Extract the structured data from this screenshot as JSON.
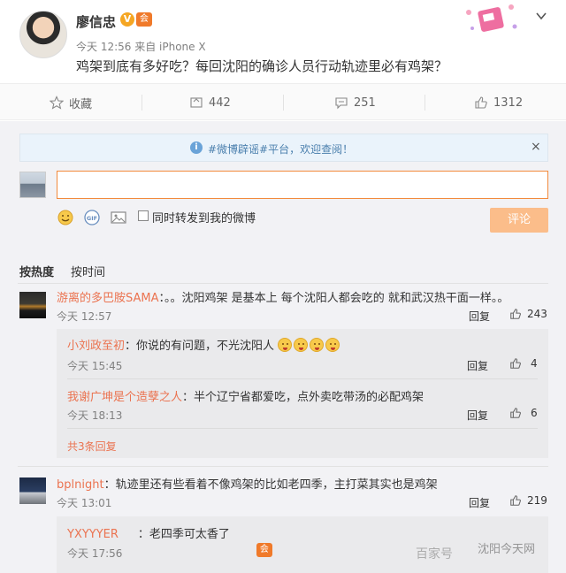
{
  "post": {
    "username": "廖信忠",
    "v_badge": "V",
    "vip_badge": "会",
    "meta": "今天 12:56 来自 iPhone X",
    "text": "鸡架到底有多好吃？每回沈阳的确诊人员行动轨迹里必有鸡架？"
  },
  "actions": {
    "favorite": "收藏",
    "repost": "442",
    "comment": "251",
    "like": "1312"
  },
  "notice": {
    "text": "#微博辟谣#平台，欢迎查阅！",
    "close": "×"
  },
  "composer": {
    "repost_label": "同时转发到我的微博",
    "submit": "评论"
  },
  "tabs": {
    "hot": "按热度",
    "time": "按时间"
  },
  "comments": [
    {
      "name": "游离的多巴胺SAMA",
      "text": "：。。沈阳鸡架 是基本上 每个沈阳人都会吃的 就和武汉热干面一样。。",
      "time": "今天 12:57",
      "reply": "回复",
      "likes": "243",
      "replies": [
        {
          "name": "小刘政至初",
          "text": "：你说的有问题，不光沈阳人",
          "time": "今天 15:45",
          "reply": "回复",
          "likes": "4"
        },
        {
          "name": "我谢广坤是个造孽之人",
          "text": "：半个辽宁省都爱吃，点外卖吃带汤的必配鸡架",
          "time": "今天 18:13",
          "reply": "回复",
          "likes": "6"
        }
      ],
      "more": "共3条回复"
    },
    {
      "name": "bplnight",
      "text": "：轨迹里还有些看着不像鸡架的比如老四季，主打菜其实也是鸡架",
      "time": "今天 13:01",
      "reply": "回复",
      "likes": "219",
      "replies": [
        {
          "name": "YXYYYER",
          "text": "：老四季可太香了",
          "time": "今天 17:56"
        }
      ]
    }
  ],
  "watermark": {
    "text": "百家号",
    "text2": "沈阳今天网"
  },
  "colors": {
    "link_orange": "#eb7350",
    "submit_disabled": "#fbbd8a",
    "notice_blue": "#4a7fad"
  }
}
